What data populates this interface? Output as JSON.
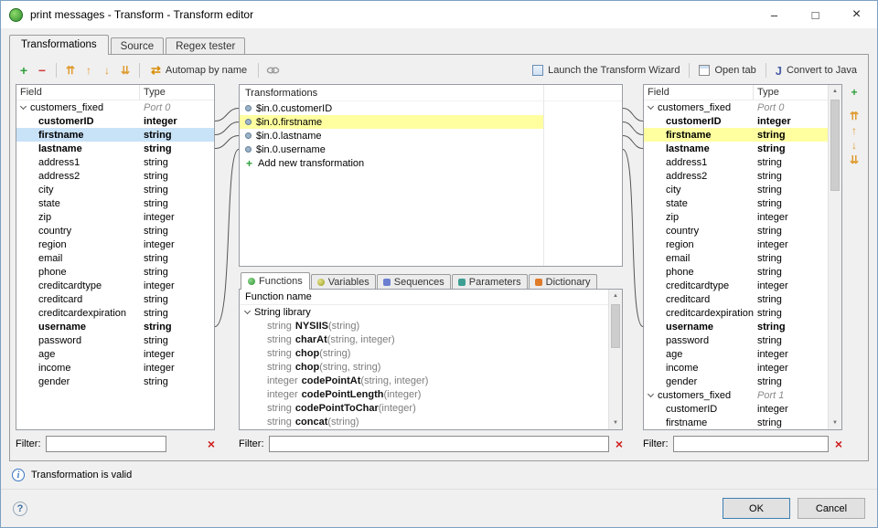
{
  "window": {
    "title": "print messages - Transform - Transform editor"
  },
  "icons": {
    "minimize": "–",
    "maximize": "□",
    "close": "×",
    "plus": "+",
    "minus": "−",
    "move_top": "⇈",
    "move_up": "↑",
    "move_down": "↓",
    "move_bottom": "⇊",
    "automap": "⇄",
    "java": "J",
    "clear": "×",
    "scroll_up": "▲",
    "scroll_down": "▼",
    "info": "i",
    "help": "?"
  },
  "tabs": [
    {
      "label": "Transformations",
      "active": true
    },
    {
      "label": "Source",
      "active": false
    },
    {
      "label": "Regex tester",
      "active": false
    }
  ],
  "toolbar": {
    "automap_label": "Automap by name",
    "wizard_label": "Launch the Transform Wizard",
    "open_tab_label": "Open tab",
    "convert_label": "Convert to Java"
  },
  "filters": {
    "label": "Filter:",
    "value": ""
  },
  "left_panel": {
    "columns": [
      "Field",
      "Type"
    ],
    "group": {
      "name": "customers_fixed",
      "port": "Port 0"
    },
    "fields": [
      {
        "name": "customerID",
        "type": "integer",
        "bold": true
      },
      {
        "name": "firstname",
        "type": "string",
        "bold": true,
        "selected": true
      },
      {
        "name": "lastname",
        "type": "string",
        "bold": true
      },
      {
        "name": "address1",
        "type": "string"
      },
      {
        "name": "address2",
        "type": "string"
      },
      {
        "name": "city",
        "type": "string"
      },
      {
        "name": "state",
        "type": "string"
      },
      {
        "name": "zip",
        "type": "integer"
      },
      {
        "name": "country",
        "type": "string"
      },
      {
        "name": "region",
        "type": "integer"
      },
      {
        "name": "email",
        "type": "string"
      },
      {
        "name": "phone",
        "type": "string"
      },
      {
        "name": "creditcardtype",
        "type": "integer"
      },
      {
        "name": "creditcard",
        "type": "string"
      },
      {
        "name": "creditcardexpiration",
        "type": "string"
      },
      {
        "name": "username",
        "type": "string",
        "bold": true
      },
      {
        "name": "password",
        "type": "string"
      },
      {
        "name": "age",
        "type": "integer"
      },
      {
        "name": "income",
        "type": "integer"
      },
      {
        "name": "gender",
        "type": "string"
      }
    ]
  },
  "transformations": {
    "title": "Transformations",
    "items": [
      {
        "label": "$in.0.customerID"
      },
      {
        "label": "$in.0.firstname",
        "highlight": true
      },
      {
        "label": "$in.0.lastname"
      },
      {
        "label": "$in.0.username"
      }
    ],
    "add_label": "Add new transformation"
  },
  "functions_panel": {
    "tabs": [
      {
        "label": "Functions",
        "active": true
      },
      {
        "label": "Variables",
        "active": false
      },
      {
        "label": "Sequences",
        "active": false
      },
      {
        "label": "Parameters",
        "active": false
      },
      {
        "label": "Dictionary",
        "active": false
      }
    ],
    "header": "Function name",
    "library": "String library",
    "functions": [
      {
        "ret": "string",
        "name": "NYSIIS",
        "args": "(string)"
      },
      {
        "ret": "string",
        "name": "charAt",
        "args": "(string, integer)"
      },
      {
        "ret": "string",
        "name": "chop",
        "args": "(string)"
      },
      {
        "ret": "string",
        "name": "chop",
        "args": "(string, string)"
      },
      {
        "ret": "integer",
        "name": "codePointAt",
        "args": "(string, integer)"
      },
      {
        "ret": "integer",
        "name": "codePointLength",
        "args": "(integer)"
      },
      {
        "ret": "string",
        "name": "codePointToChar",
        "args": "(integer)"
      },
      {
        "ret": "string",
        "name": "concat",
        "args": "(string)"
      }
    ]
  },
  "right_panel": {
    "columns": [
      "Field",
      "Type"
    ],
    "groups": [
      {
        "name": "customers_fixed",
        "port": "Port 0",
        "fields": [
          {
            "name": "customerID",
            "type": "integer",
            "bold": true
          },
          {
            "name": "firstname",
            "type": "string",
            "bold": true,
            "highlight": true
          },
          {
            "name": "lastname",
            "type": "string",
            "bold": true
          },
          {
            "name": "address1",
            "type": "string"
          },
          {
            "name": "address2",
            "type": "string"
          },
          {
            "name": "city",
            "type": "string"
          },
          {
            "name": "state",
            "type": "string"
          },
          {
            "name": "zip",
            "type": "integer"
          },
          {
            "name": "country",
            "type": "string"
          },
          {
            "name": "region",
            "type": "integer"
          },
          {
            "name": "email",
            "type": "string"
          },
          {
            "name": "phone",
            "type": "string"
          },
          {
            "name": "creditcardtype",
            "type": "integer"
          },
          {
            "name": "creditcard",
            "type": "string"
          },
          {
            "name": "creditcardexpiration",
            "type": "string"
          },
          {
            "name": "username",
            "type": "string",
            "bold": true
          },
          {
            "name": "password",
            "type": "string"
          },
          {
            "name": "age",
            "type": "integer"
          },
          {
            "name": "income",
            "type": "integer"
          },
          {
            "name": "gender",
            "type": "string"
          }
        ]
      },
      {
        "name": "customers_fixed",
        "port": "Port 1",
        "fields": [
          {
            "name": "customerID",
            "type": "integer"
          },
          {
            "name": "firstname",
            "type": "string"
          }
        ]
      }
    ]
  },
  "status": {
    "message": "Transformation is valid"
  },
  "footer": {
    "ok": "OK",
    "cancel": "Cancel"
  }
}
